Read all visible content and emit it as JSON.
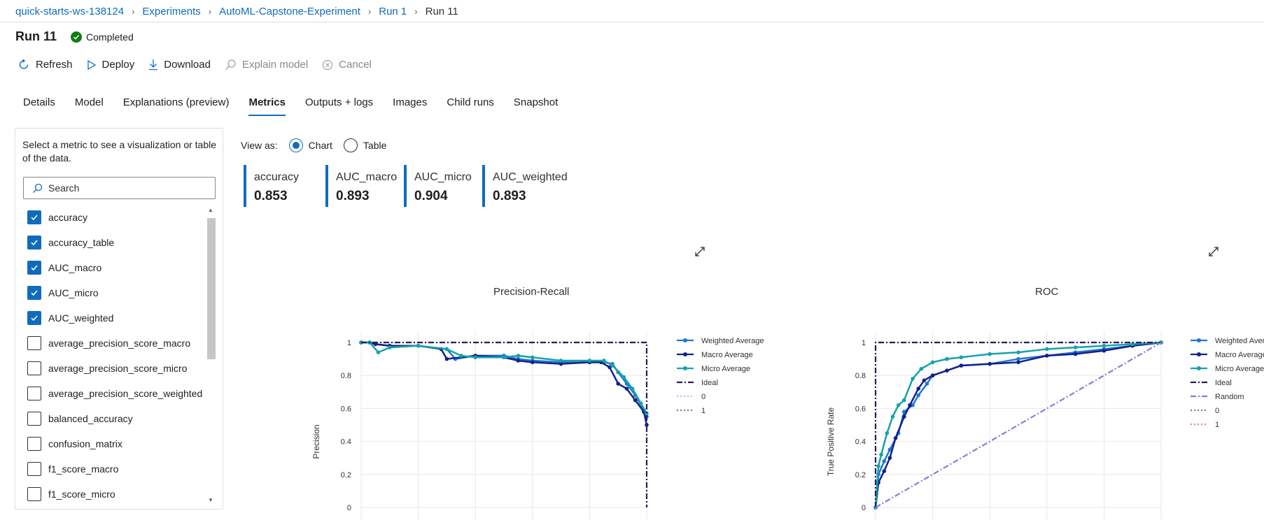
{
  "breadcrumb": {
    "items": [
      "quick-starts-ws-138124",
      "Experiments",
      "AutoML-Capstone-Experiment",
      "Run 1"
    ],
    "current": "Run 11"
  },
  "title": "Run 11",
  "status": "Completed",
  "toolbar": {
    "refresh": "Refresh",
    "deploy": "Deploy",
    "download": "Download",
    "explain": "Explain model",
    "cancel": "Cancel"
  },
  "tabs": [
    "Details",
    "Model",
    "Explanations (preview)",
    "Metrics",
    "Outputs + logs",
    "Images",
    "Child runs",
    "Snapshot"
  ],
  "active_tab": "Metrics",
  "panel": {
    "description": "Select a metric to see a visualization or table of the data.",
    "search_placeholder": "Search",
    "metrics": [
      {
        "label": "accuracy",
        "checked": true
      },
      {
        "label": "accuracy_table",
        "checked": true
      },
      {
        "label": "AUC_macro",
        "checked": true
      },
      {
        "label": "AUC_micro",
        "checked": true
      },
      {
        "label": "AUC_weighted",
        "checked": true
      },
      {
        "label": "average_precision_score_macro",
        "checked": false
      },
      {
        "label": "average_precision_score_micro",
        "checked": false
      },
      {
        "label": "average_precision_score_weighted",
        "checked": false
      },
      {
        "label": "balanced_accuracy",
        "checked": false
      },
      {
        "label": "confusion_matrix",
        "checked": false
      },
      {
        "label": "f1_score_macro",
        "checked": false
      },
      {
        "label": "f1_score_micro",
        "checked": false
      }
    ]
  },
  "view_as": {
    "label": "View as:",
    "chart": "Chart",
    "table": "Table",
    "selected": "Chart"
  },
  "cards": [
    {
      "label": "accuracy",
      "value": "0.853"
    },
    {
      "label": "AUC_macro",
      "value": "0.893"
    },
    {
      "label": "AUC_micro",
      "value": "0.904"
    },
    {
      "label": "AUC_weighted",
      "value": "0.893"
    }
  ],
  "colors": {
    "accent": "#0f6cbd",
    "weighted": "#1f77d4",
    "macro": "#14218c",
    "micro": "#17a2a8",
    "ideal": "#2a1b5c",
    "random": "#8b7bd8",
    "class0_pr": "#c2b8f0",
    "class1_pr": "#8a7a7a",
    "class0_roc": "#8a7a7a",
    "class1_roc": "#e377c2"
  },
  "chart_data": [
    {
      "type": "line",
      "title": "Precision-Recall",
      "xlabel": "",
      "ylabel": "Precision",
      "ylim": [
        0,
        1
      ],
      "yticks": [
        "0",
        "0.2",
        "0.4",
        "0.6",
        "0.8",
        "1"
      ],
      "legend": [
        "Weighted Average",
        "Macro Average",
        "Micro Average",
        "Ideal",
        "0",
        "1"
      ],
      "series": [
        {
          "name": "Weighted Average",
          "x": [
            0,
            0.03,
            0.05,
            0.1,
            0.2,
            0.3,
            0.33,
            0.4,
            0.5,
            0.55,
            0.6,
            0.7,
            0.8,
            0.85,
            0.88,
            0.9,
            0.93,
            0.96,
            0.99,
            1.0
          ],
          "y": [
            1.0,
            1.0,
            0.99,
            0.98,
            0.98,
            0.96,
            0.9,
            0.92,
            0.92,
            0.9,
            0.89,
            0.88,
            0.88,
            0.88,
            0.87,
            0.82,
            0.75,
            0.68,
            0.59,
            0.55
          ]
        },
        {
          "name": "Macro Average",
          "x": [
            0,
            0.03,
            0.05,
            0.1,
            0.2,
            0.28,
            0.3,
            0.4,
            0.5,
            0.55,
            0.6,
            0.7,
            0.8,
            0.84,
            0.87,
            0.9,
            0.93,
            0.96,
            0.99,
            1.0
          ],
          "y": [
            1.0,
            1.0,
            0.99,
            0.98,
            0.98,
            0.96,
            0.9,
            0.92,
            0.91,
            0.89,
            0.88,
            0.87,
            0.88,
            0.88,
            0.85,
            0.75,
            0.72,
            0.65,
            0.58,
            0.5
          ]
        },
        {
          "name": "Micro Average",
          "x": [
            0,
            0.03,
            0.06,
            0.1,
            0.2,
            0.3,
            0.35,
            0.4,
            0.5,
            0.55,
            0.6,
            0.7,
            0.8,
            0.85,
            0.88,
            0.92,
            0.95,
            0.98,
            1.0
          ],
          "y": [
            1.0,
            1.0,
            0.94,
            0.97,
            0.98,
            0.96,
            0.92,
            0.91,
            0.91,
            0.92,
            0.91,
            0.89,
            0.89,
            0.89,
            0.86,
            0.79,
            0.72,
            0.63,
            0.57
          ]
        },
        {
          "name": "Ideal",
          "x": [
            0,
            1,
            1
          ],
          "y": [
            1,
            1,
            0
          ]
        }
      ]
    },
    {
      "type": "line",
      "title": "ROC",
      "xlabel": "",
      "ylabel": "True Positive Rate",
      "ylim": [
        0,
        1
      ],
      "yticks": [
        "0",
        "0.2",
        "0.4",
        "0.6",
        "0.8",
        "1"
      ],
      "legend": [
        "Weighted Average",
        "Macro Average",
        "Micro Average",
        "Ideal",
        "Random",
        "0",
        "1"
      ],
      "series": [
        {
          "name": "Weighted Average",
          "x": [
            0,
            0.01,
            0.03,
            0.05,
            0.08,
            0.1,
            0.13,
            0.15,
            0.18,
            0.2,
            0.25,
            0.3,
            0.4,
            0.5,
            0.6,
            0.7,
            0.8,
            0.9,
            1.0
          ],
          "y": [
            0,
            0.2,
            0.28,
            0.35,
            0.45,
            0.58,
            0.62,
            0.68,
            0.75,
            0.8,
            0.83,
            0.86,
            0.87,
            0.9,
            0.92,
            0.94,
            0.96,
            0.98,
            1.0
          ]
        },
        {
          "name": "Macro Average",
          "x": [
            0,
            0.01,
            0.03,
            0.05,
            0.07,
            0.1,
            0.12,
            0.15,
            0.17,
            0.2,
            0.25,
            0.3,
            0.4,
            0.5,
            0.6,
            0.7,
            0.8,
            0.9,
            1.0
          ],
          "y": [
            0,
            0.15,
            0.22,
            0.3,
            0.42,
            0.55,
            0.62,
            0.72,
            0.77,
            0.8,
            0.83,
            0.86,
            0.87,
            0.88,
            0.92,
            0.93,
            0.95,
            0.98,
            1.0
          ]
        },
        {
          "name": "Micro Average",
          "x": [
            0,
            0.01,
            0.02,
            0.04,
            0.06,
            0.08,
            0.1,
            0.13,
            0.16,
            0.2,
            0.25,
            0.3,
            0.4,
            0.5,
            0.6,
            0.7,
            0.8,
            0.9,
            1.0
          ],
          "y": [
            0,
            0.25,
            0.32,
            0.45,
            0.55,
            0.62,
            0.65,
            0.78,
            0.84,
            0.88,
            0.9,
            0.91,
            0.93,
            0.94,
            0.96,
            0.97,
            0.98,
            0.99,
            1.0
          ]
        },
        {
          "name": "Ideal",
          "x": [
            0,
            0,
            1
          ],
          "y": [
            0,
            1,
            1
          ]
        },
        {
          "name": "Random",
          "x": [
            0,
            1
          ],
          "y": [
            0,
            1
          ]
        }
      ]
    }
  ]
}
